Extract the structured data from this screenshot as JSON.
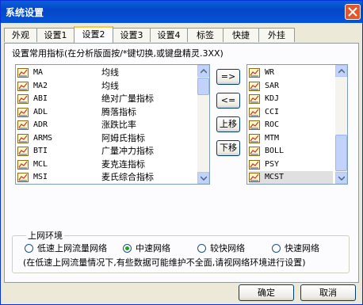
{
  "window": {
    "title": "系统设置"
  },
  "tabs": [
    {
      "label": "外观"
    },
    {
      "label": "设置1"
    },
    {
      "label": "设置2",
      "active": true
    },
    {
      "label": "设置3"
    },
    {
      "label": "设置4"
    },
    {
      "label": "标签"
    },
    {
      "label": "快捷"
    },
    {
      "label": "外挂"
    }
  ],
  "panel": {
    "hint": "设置常用指标(在分析版面按/*键切换,或键盘精灵.3XX)",
    "available_indicators": [
      {
        "code": "MA",
        "name": "均线"
      },
      {
        "code": "MA2",
        "name": "均线"
      },
      {
        "code": "ABI",
        "name": "绝对广量指标"
      },
      {
        "code": "ADL",
        "name": "腾落指标"
      },
      {
        "code": "ADR",
        "name": "涨跌比率"
      },
      {
        "code": "ARMS",
        "name": "阿姆氏指标"
      },
      {
        "code": "BTI",
        "name": "广量冲力指标"
      },
      {
        "code": "MCL",
        "name": "麦克连指标"
      },
      {
        "code": "MSI",
        "name": "麦氏综合指标"
      }
    ],
    "selected_indicators": [
      {
        "code": "WR"
      },
      {
        "code": "SAR"
      },
      {
        "code": "KDJ"
      },
      {
        "code": "CCI"
      },
      {
        "code": "ROC"
      },
      {
        "code": "MTM"
      },
      {
        "code": "BOLL"
      },
      {
        "code": "PSY"
      },
      {
        "code": "MCST",
        "selected": true
      }
    ],
    "buttons": {
      "add": "=>",
      "remove": "<=",
      "move_up": "上移",
      "move_down": "下移"
    },
    "network": {
      "title": "上网环境",
      "options": [
        {
          "label": "低速上网流量网络",
          "checked": false
        },
        {
          "label": "中速网络",
          "checked": true
        },
        {
          "label": "较快网络",
          "checked": false
        },
        {
          "label": "快速网络",
          "checked": false
        }
      ],
      "note": "(在低速上网流量情况下,有些数据可能维护不全面,请视网络环境进行设置)"
    }
  },
  "footer": {
    "ok": "确定",
    "cancel": "取消"
  },
  "colors": {
    "accent": "#0a5fd9",
    "close": "#e2552d",
    "radio_on": "#21a121"
  }
}
